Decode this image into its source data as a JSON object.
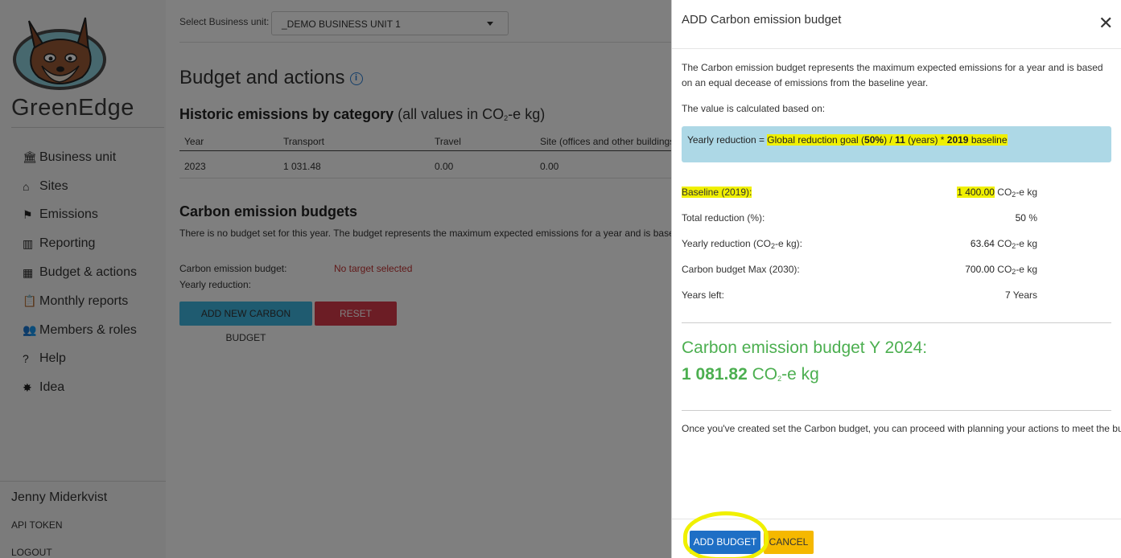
{
  "sidebar": {
    "brand": "GreenEdge",
    "items": [
      {
        "label": "Business unit",
        "icon": "bank-icon",
        "glyph": "🏛"
      },
      {
        "label": "Sites",
        "icon": "home-icon",
        "glyph": "⌂"
      },
      {
        "label": "Emissions",
        "icon": "factory-icon",
        "glyph": "⚑"
      },
      {
        "label": "Reporting",
        "icon": "chart-icon",
        "glyph": "▥"
      },
      {
        "label": "Budget & actions",
        "icon": "calculator-icon",
        "glyph": "▦"
      },
      {
        "label": "Monthly reports",
        "icon": "clipboard-icon",
        "glyph": "📋"
      },
      {
        "label": "Members & roles",
        "icon": "users-icon",
        "glyph": "👥"
      },
      {
        "label": "Help",
        "icon": "question-icon",
        "glyph": "?"
      },
      {
        "label": "Idea",
        "icon": "lightbulb-icon",
        "glyph": "✸"
      }
    ],
    "user_name": "Jenny Miderkvist",
    "api_token": "API TOKEN",
    "logout": "LOGOUT"
  },
  "main": {
    "bu_label": "Select Business unit:",
    "bu_value": "_DEMO BUSINESS UNIT 1",
    "title": "Budget and actions",
    "hist_title": "Historic emissions by category",
    "hist_note_pre": "(all values in CO",
    "hist_note_sub": "2",
    "hist_note_post": "-e kg)",
    "table": {
      "headers": [
        "Year",
        "Transport",
        "Travel",
        "Site (offices and other buildings)"
      ],
      "rows": [
        [
          "2023",
          "1 031.48",
          "0.00",
          "0.00"
        ]
      ]
    },
    "budget_title": "Carbon emission budgets",
    "budget_desc": "There is no budget set for this year. The budget represents the maximum expected emissions for a year and is based on an ec",
    "ceb_label": "Carbon emission budget:",
    "ceb_value": "No target selected",
    "yearly_label": "Yearly reduction:",
    "add_btn": "ADD NEW CARBON BUDGET",
    "reset_btn": "RESET BASELINE"
  },
  "modal": {
    "title": "ADD Carbon emission budget",
    "desc": "The Carbon emission budget represents the maximum expected emissions for a year and is based on an equal decease of emissions from the baseline year.",
    "calc_label": "The value is calculated based on:",
    "formula": {
      "prefix": "Yearly reduction = ",
      "hl1": "Global reduction goal (",
      "goal": "50%",
      "hl2": ") / ",
      "years": "11",
      "hl3": " (years) * ",
      "year": "2019",
      "hl4": " baseline"
    },
    "stats": [
      {
        "label": "Baseline (2019):",
        "value": "1 400.00",
        "unit_pre": " CO",
        "unit_sub": "2",
        "unit_post": "-e kg",
        "highlight": true
      },
      {
        "label": "Total reduction (%):",
        "value": "50",
        "unit_pre": " %",
        "unit_sub": "",
        "unit_post": "",
        "highlight": false
      },
      {
        "label_pre": "Yearly reduction (CO",
        "label_sub": "2",
        "label_post": "-e kg):",
        "value": "63.64",
        "unit_pre": " CO",
        "unit_sub": "2",
        "unit_post": "-e kg",
        "highlight": false
      },
      {
        "label": "Carbon budget Max (2030):",
        "value": "700.00",
        "unit_pre": " CO",
        "unit_sub": "2",
        "unit_post": "-e kg",
        "highlight": false
      },
      {
        "label": "Years left:",
        "value": "7",
        "unit_pre": " Years",
        "unit_sub": "",
        "unit_post": "",
        "highlight": false
      }
    ],
    "result_line1": "Carbon emission budget Y 2024:",
    "result_value": "1 081.82",
    "result_unit_pre": " CO",
    "result_unit_sub": "2",
    "result_unit_post": "-e kg",
    "note": "Once you've created set the Carbon budget, you can proceed with planning your actions to meet the budget.",
    "add_btn": "ADD BUDGET",
    "cancel_btn": "CANCEL"
  },
  "colors": {
    "accent_green": "#4caf50",
    "primary_blue": "#1e6fc5",
    "warning_yellow": "#f5b800",
    "highlight": "#f0f000",
    "formula_bg": "#add8e6"
  }
}
